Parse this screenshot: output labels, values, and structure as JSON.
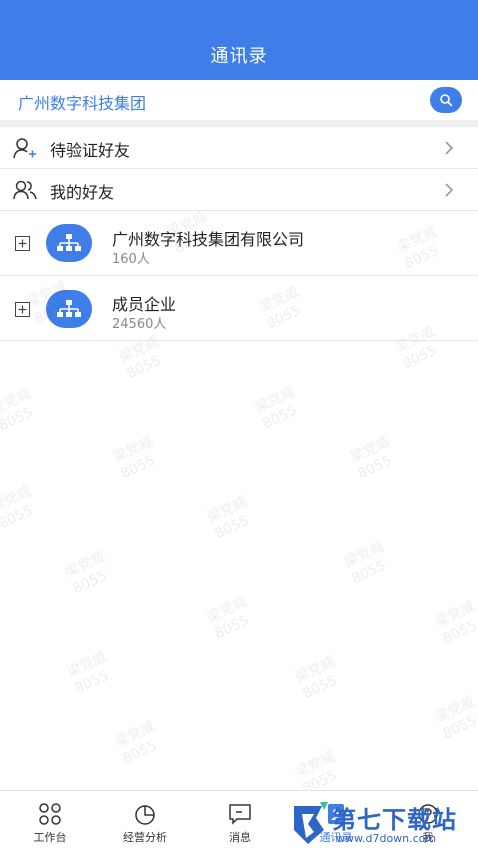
{
  "header": {
    "title": "通讯录"
  },
  "search": {
    "text": "广州数字科技集团"
  },
  "menu": [
    {
      "label": "待验证好友",
      "icon": "add-user-icon"
    },
    {
      "label": "我的好友",
      "icon": "users-icon"
    }
  ],
  "groups": [
    {
      "name": "广州数字科技集团有限公司",
      "count": "160人"
    },
    {
      "name": "成员企业",
      "count": "24560人"
    }
  ],
  "watermark": {
    "line1": "梁党威",
    "line2": "8055"
  },
  "tabs": [
    {
      "label": "工作台",
      "icon": "grid-icon"
    },
    {
      "label": "经营分析",
      "icon": "pie-chart-icon"
    },
    {
      "label": "消息",
      "icon": "message-icon"
    },
    {
      "label": "通讯录",
      "icon": "contacts-icon"
    },
    {
      "label": "我",
      "icon": "profile-icon"
    }
  ],
  "brand": {
    "name": "第七下载站",
    "url": "www.d7down.com"
  },
  "colors": {
    "primary": "#3f7ee8",
    "brand": "#2d66c6"
  }
}
